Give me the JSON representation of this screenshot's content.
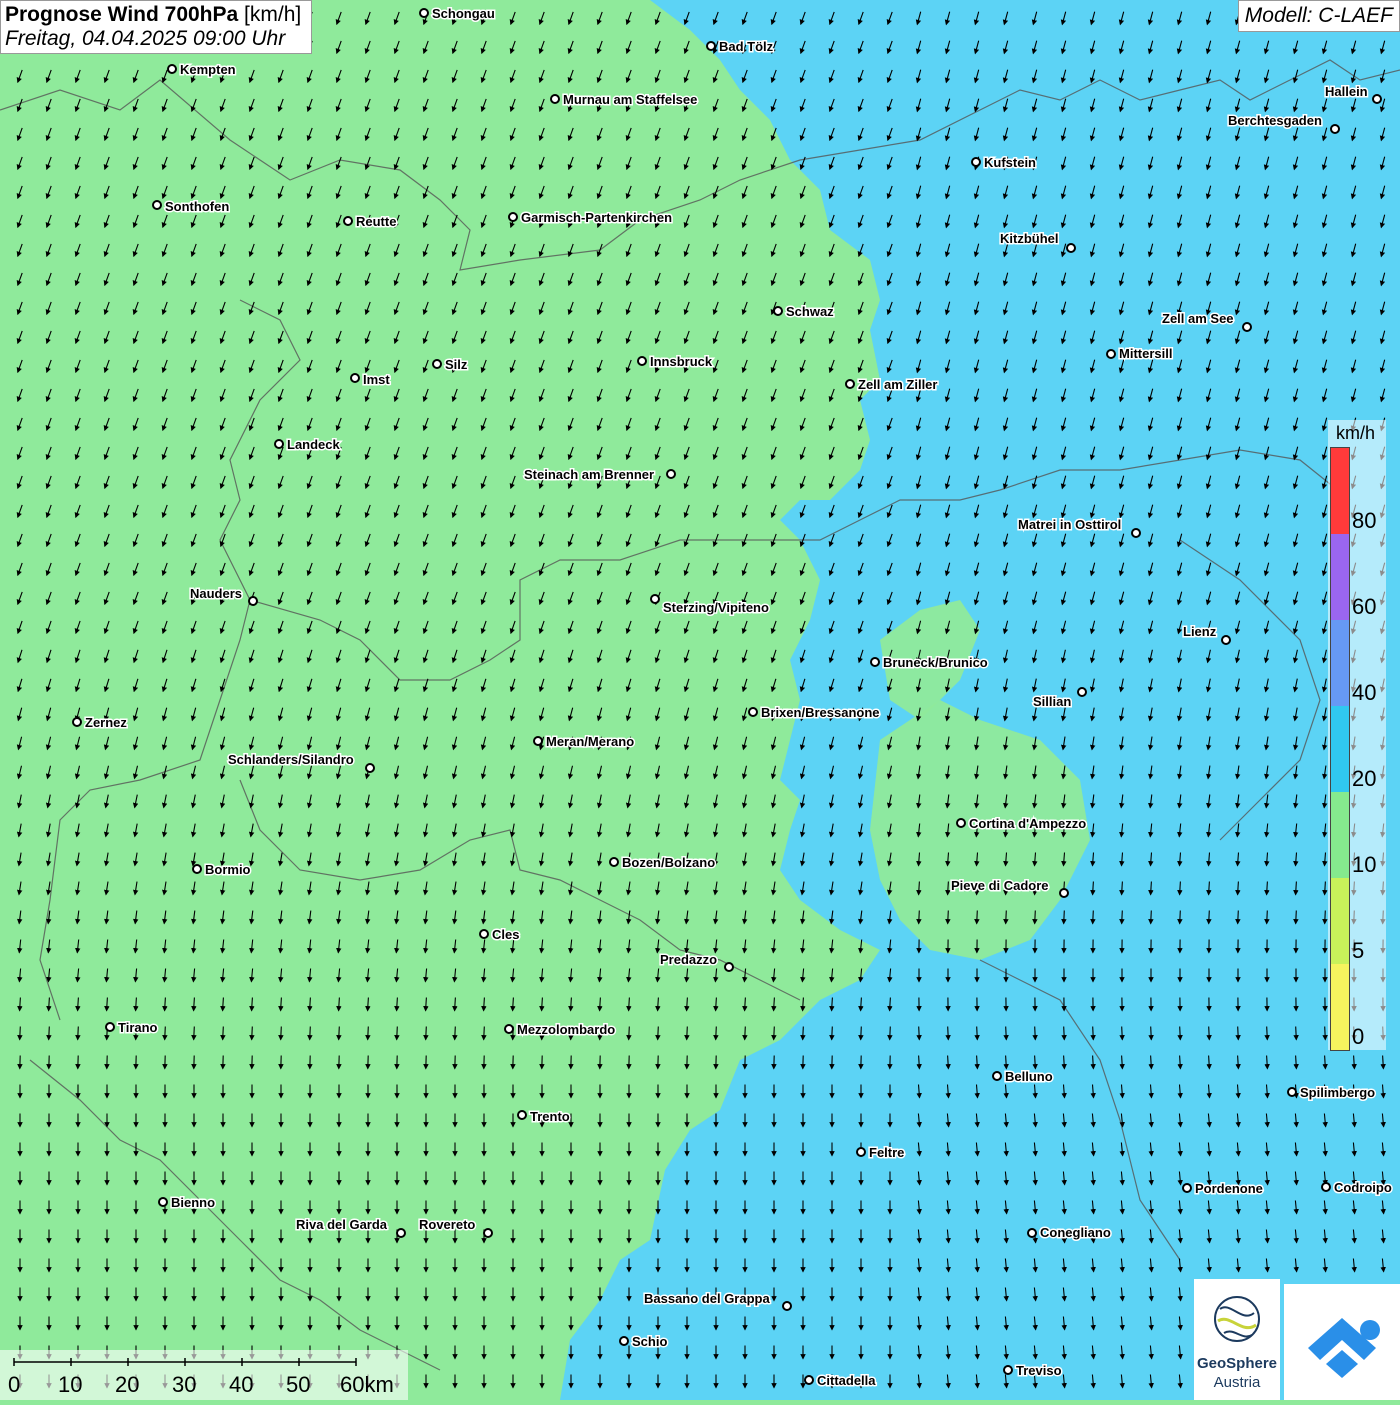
{
  "header": {
    "title_bold": "Prognose Wind 700hPa",
    "title_unit": "[km/h]",
    "datetime": "Freitag, 04.04.2025 09:00 Uhr",
    "model": "Modell: C-LAEF"
  },
  "legend": {
    "unit": "km/h",
    "ticks": [
      "80",
      "60",
      "40",
      "20",
      "10",
      "5",
      "0"
    ],
    "colors": [
      "#ff3a3a",
      "#9a66f0",
      "#6699f5",
      "#30c8f0",
      "#85ea8e",
      "#c9f25a",
      "#f6f45e"
    ]
  },
  "scalebar": {
    "labels": [
      "0",
      "10",
      "20",
      "30",
      "40",
      "50",
      "60km"
    ]
  },
  "cities": [
    {
      "name": "Schongau"
    },
    {
      "name": "Bad Tölz"
    },
    {
      "name": "Kempten"
    },
    {
      "name": "Murnau am Staffelsee"
    },
    {
      "name": "Hallein"
    },
    {
      "name": "Berchtesgaden"
    },
    {
      "name": "Kufstein"
    },
    {
      "name": "Sonthofen"
    },
    {
      "name": "Reutte"
    },
    {
      "name": "Garmisch-Partenkirchen"
    },
    {
      "name": "Kitzbühel"
    },
    {
      "name": "Schwaz"
    },
    {
      "name": "Zell am See"
    },
    {
      "name": "Mittersill"
    },
    {
      "name": "Innsbruck"
    },
    {
      "name": "Silz"
    },
    {
      "name": "Imst"
    },
    {
      "name": "Zell am Ziller"
    },
    {
      "name": "Landeck"
    },
    {
      "name": "Steinach am Brenner"
    },
    {
      "name": "Matrei in Osttirol"
    },
    {
      "name": "Nauders"
    },
    {
      "name": "Sterzing/Vipiteno"
    },
    {
      "name": "Lienz"
    },
    {
      "name": "Bruneck/Brunico"
    },
    {
      "name": "Sillian"
    },
    {
      "name": "Brixen/Bressanone"
    },
    {
      "name": "Zernez"
    },
    {
      "name": "Meran/Merano"
    },
    {
      "name": "Schlanders/Silandro"
    },
    {
      "name": "Cortina d'Ampezzo"
    },
    {
      "name": "Bozen/Bolzano"
    },
    {
      "name": "Bormio"
    },
    {
      "name": "Pieve di Cadore"
    },
    {
      "name": "Cles"
    },
    {
      "name": "Predazzo"
    },
    {
      "name": "Tirano"
    },
    {
      "name": "Mezzolombardo"
    },
    {
      "name": "Belluno"
    },
    {
      "name": "Spilimbergo"
    },
    {
      "name": "Trento"
    },
    {
      "name": "Feltre"
    },
    {
      "name": "Pordenone"
    },
    {
      "name": "Codroipo"
    },
    {
      "name": "Bienno"
    },
    {
      "name": "Riva del Garda"
    },
    {
      "name": "Rovereto"
    },
    {
      "name": "Conegliano"
    },
    {
      "name": "Bassano del Grappa"
    },
    {
      "name": "Schio"
    },
    {
      "name": "Treviso"
    },
    {
      "name": "Cittadella"
    }
  ],
  "logos": {
    "geosphere_name": "GeoSphere",
    "geosphere_sub": "Austria"
  },
  "colors": {
    "green_zone": "#8fea9b",
    "blue_zone": "#5cd3f5",
    "border": "#555555"
  }
}
